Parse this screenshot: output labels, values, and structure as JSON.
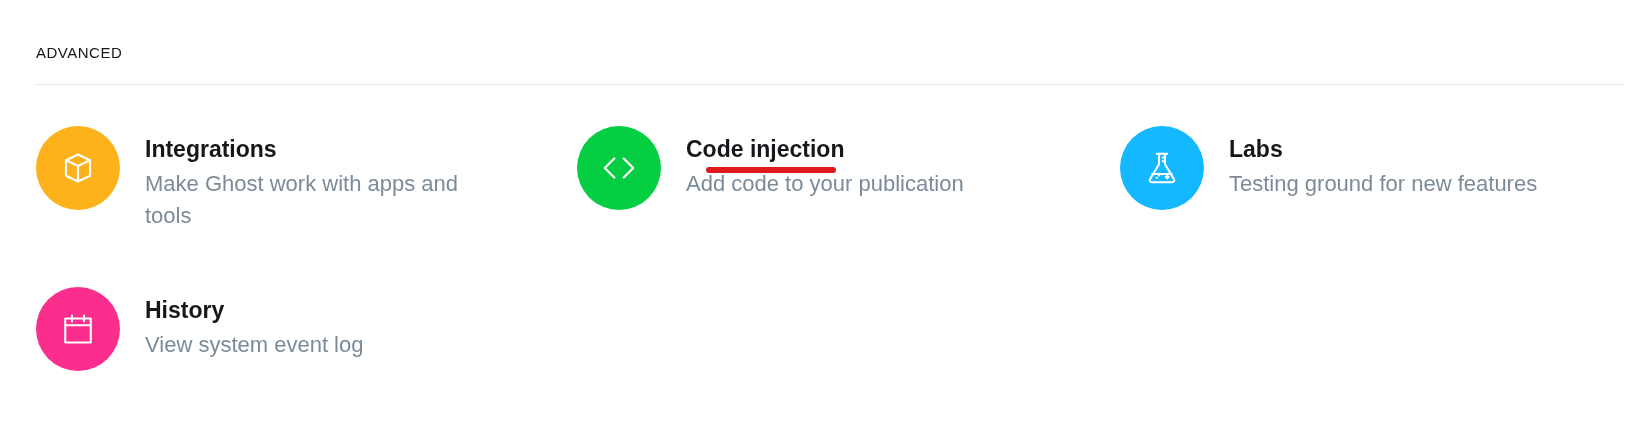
{
  "section": {
    "heading": "ADVANCED"
  },
  "items": [
    {
      "title": "Integrations",
      "description": "Make Ghost work with apps and tools",
      "color": "#fdb21c",
      "underlined": false
    },
    {
      "title": "Code injection",
      "description": "Add code to your publication",
      "color": "#06ce42",
      "underlined": true
    },
    {
      "title": "Labs",
      "description": "Testing ground for new features",
      "color": "#14b8ff",
      "underlined": false
    },
    {
      "title": "History",
      "description": "View system event log",
      "color": "#fb2d8d",
      "underlined": false
    }
  ]
}
